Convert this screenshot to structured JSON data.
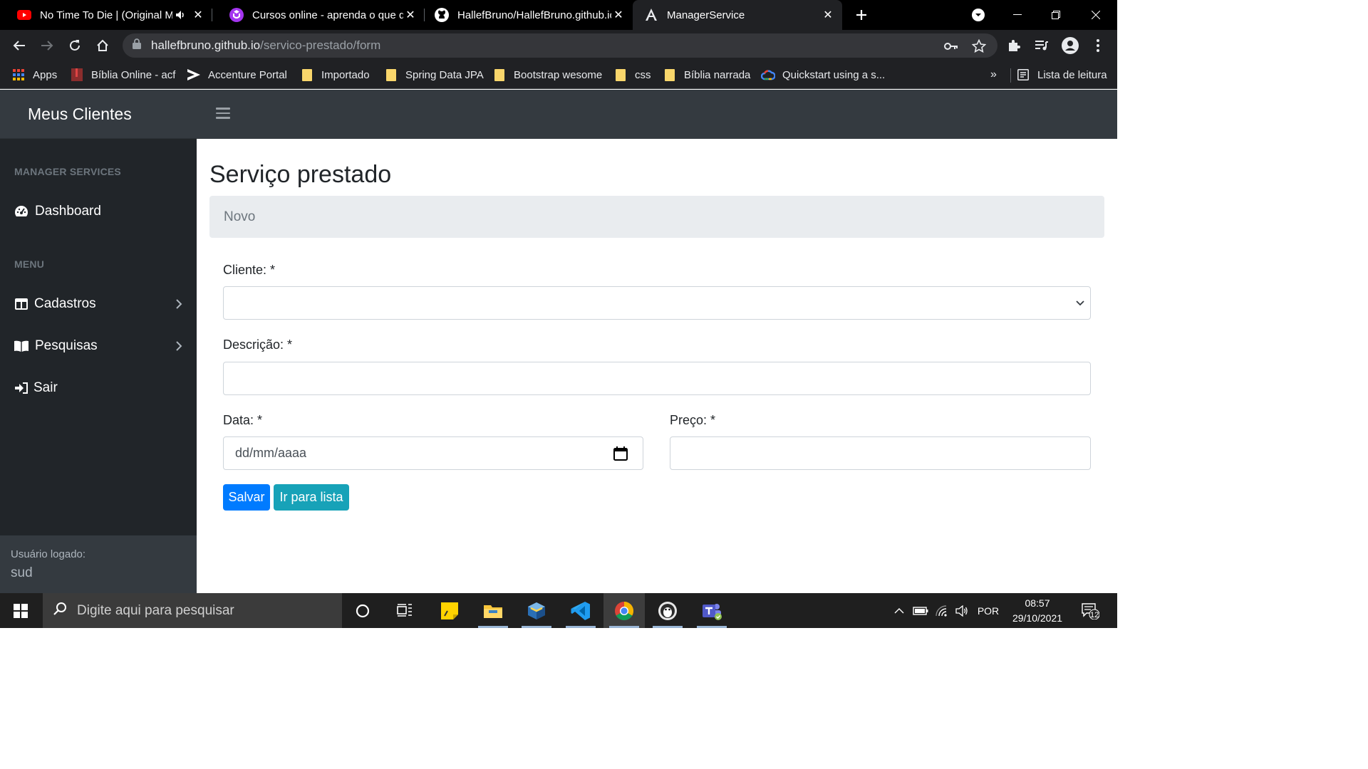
{
  "browser": {
    "tabs": [
      {
        "title": "No Time To Die | (Original Mo",
        "icon": "youtube-icon"
      },
      {
        "title": "Cursos online - aprenda o que qu",
        "icon": "udemy-icon"
      },
      {
        "title": "HallefBruno/HallefBruno.github.io",
        "icon": "github-icon"
      },
      {
        "title": "ManagerService",
        "icon": "angular-icon",
        "active": true
      }
    ],
    "url_host": "hallefbruno.github.io",
    "url_path": "/servico-prestado/form",
    "bookmarks": [
      {
        "label": "Apps"
      },
      {
        "label": "Bíblia Online - acf"
      },
      {
        "label": "Accenture Portal"
      },
      {
        "label": "Importado"
      },
      {
        "label": "Spring Data JPA"
      },
      {
        "label": "Bootstrap wesome"
      },
      {
        "label": "css"
      },
      {
        "label": "Bíblia narrada"
      },
      {
        "label": "Quickstart using a s..."
      }
    ],
    "bookmarks_overflow": "»",
    "reading_list": "Lista de leitura"
  },
  "app": {
    "brand": "Meus Clientes",
    "sidebar": {
      "section_manager": "MANAGER SERVICES",
      "dashboard": "Dashboard",
      "section_menu": "MENU",
      "cadastros": "Cadastros",
      "pesquisas": "Pesquisas",
      "sair": "Sair",
      "user_label": "Usuário logado:",
      "user_name": "sud"
    },
    "page_title": "Serviço prestado",
    "breadcrumb": "Novo",
    "form": {
      "cliente_label": "Cliente: *",
      "cliente_value": "",
      "descricao_label": "Descrição: *",
      "descricao_value": "",
      "data_label": "Data: *",
      "data_placeholder": "dd/mm/aaaa",
      "preco_label": "Preço: *",
      "preco_value": "",
      "save_button": "Salvar",
      "list_button": "Ir para lista"
    }
  },
  "taskbar": {
    "search_placeholder": "Digite aqui para pesquisar",
    "language": "POR",
    "time": "08:57",
    "date": "29/10/2021",
    "notifications": "12"
  },
  "colors": {
    "sidebar": "#212529",
    "header": "#343a40",
    "primary": "#007bff",
    "info": "#17a2b8"
  }
}
